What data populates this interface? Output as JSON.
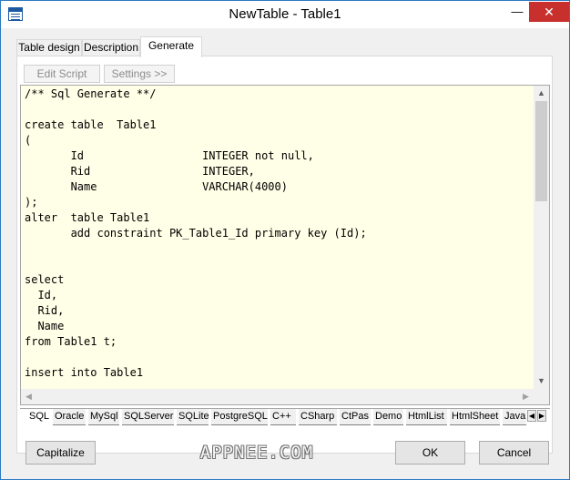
{
  "window": {
    "title": "NewTable - Table1",
    "minimize_glyph": "—",
    "close_glyph": "✕"
  },
  "tabs": [
    {
      "label": "Table design"
    },
    {
      "label": "Description"
    },
    {
      "label": "Generate"
    }
  ],
  "toolbar": {
    "edit_script": "Edit Script",
    "settings": "Settings >>"
  },
  "editor": {
    "code": "/** Sql Generate **/\n\ncreate table  Table1\n(\n       Id                  INTEGER not null,\n       Rid                 INTEGER,\n       Name                VARCHAR(4000)\n);\nalter  table Table1\n       add constraint PK_Table1_Id primary key (Id);\n\n\nselect\n  Id,\n  Rid,\n  Name\nfrom Table1 t;\n\ninsert into Table1",
    "background": "#fffee6"
  },
  "bottom_tabs": [
    {
      "label": "SQL"
    },
    {
      "label": "Oracle"
    },
    {
      "label": "MySql"
    },
    {
      "label": "SQLServer"
    },
    {
      "label": "SQLite"
    },
    {
      "label": "PostgreSQL"
    },
    {
      "label": "C++"
    },
    {
      "label": "CSharp"
    },
    {
      "label": "CtPas"
    },
    {
      "label": "Demo"
    },
    {
      "label": "HtmlList"
    },
    {
      "label": "HtmlSheet"
    },
    {
      "label": "Java"
    }
  ],
  "buttons": {
    "capitalize": "Capitalize",
    "ok": "OK",
    "cancel": "Cancel"
  },
  "watermark": "APPNEE.COM",
  "colors": {
    "close_button": "#c7302c",
    "title_border": "#2b79c2"
  }
}
